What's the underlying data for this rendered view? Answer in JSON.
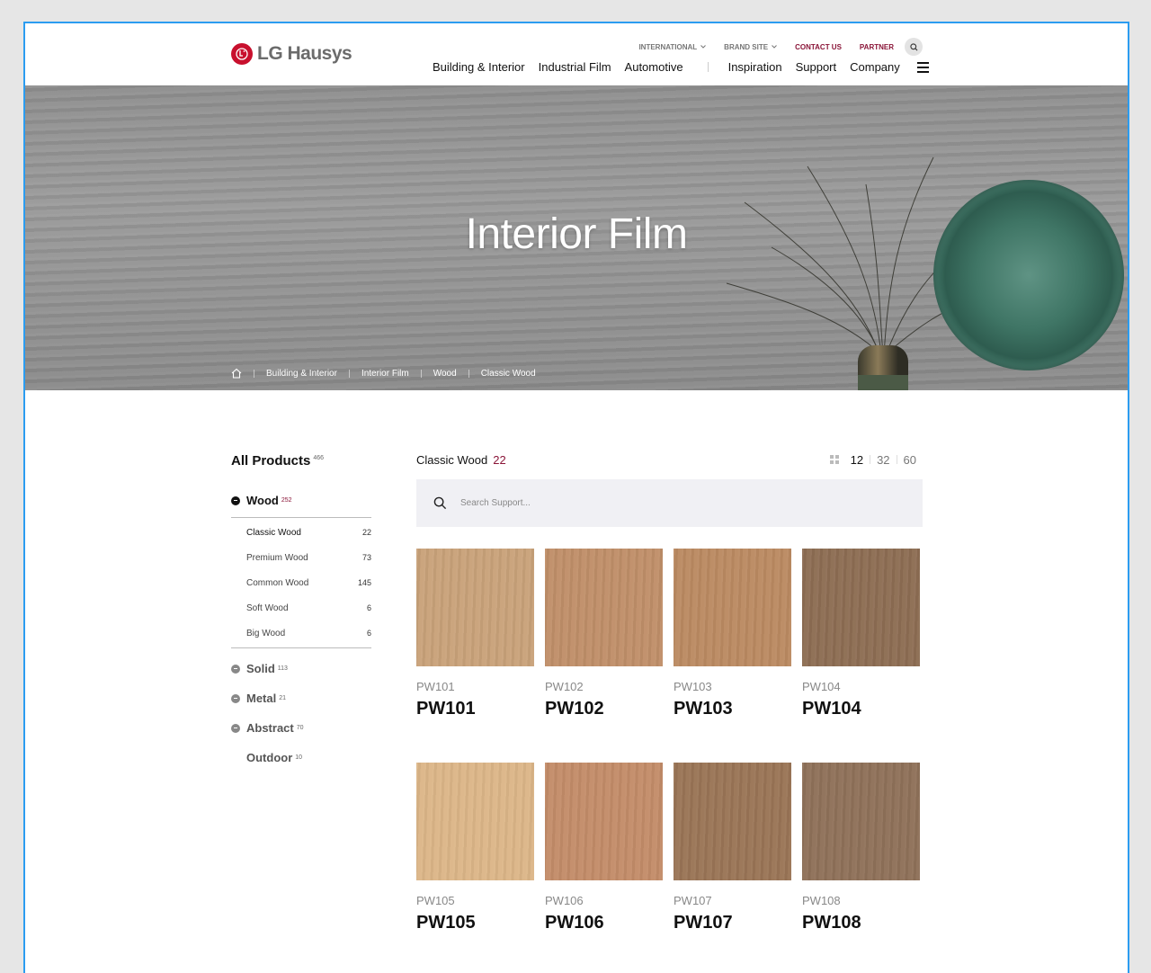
{
  "brand": {
    "name": "LG Hausys",
    "logo_letters": "LG",
    "accent": "#c8102e"
  },
  "utility_nav": {
    "international": "INTERNATIONAL",
    "brand_site": "BRAND SITE",
    "contact_us": "CONTACT US",
    "partner": "PARTNER"
  },
  "main_nav": {
    "building": "Building & Interior",
    "industrial": "Industrial Film",
    "automotive": "Automotive",
    "inspiration": "Inspiration",
    "support": "Support",
    "company": "Company"
  },
  "hero": {
    "title": "Interior Film"
  },
  "breadcrumb": [
    "Building & Interior",
    "Interior Film",
    "Wood",
    "Classic Wood"
  ],
  "sidebar": {
    "all_products": {
      "label": "All Products",
      "count": "466"
    },
    "categories": [
      {
        "label": "Wood",
        "count": "252"
      },
      {
        "label": "Solid",
        "count": "113"
      },
      {
        "label": "Metal",
        "count": "21"
      },
      {
        "label": "Abstract",
        "count": "70"
      },
      {
        "label": "Outdoor",
        "count": "10"
      }
    ],
    "wood_subs": [
      {
        "label": "Classic Wood",
        "count": "22"
      },
      {
        "label": "Premium Wood",
        "count": "73"
      },
      {
        "label": "Common Wood",
        "count": "145"
      },
      {
        "label": "Soft Wood",
        "count": "6"
      },
      {
        "label": "Big Wood",
        "count": "6"
      }
    ]
  },
  "content": {
    "title": "Classic Wood",
    "count": "22",
    "per_page": [
      "12",
      "32",
      "60"
    ],
    "search_placeholder": "Search Support..."
  },
  "products": [
    {
      "code": "PW101",
      "name": "PW101",
      "color": "#c9a27a"
    },
    {
      "code": "PW102",
      "name": "PW102",
      "color": "#c08f69"
    },
    {
      "code": "PW103",
      "name": "PW103",
      "color": "#bb8a62"
    },
    {
      "code": "PW104",
      "name": "PW104",
      "color": "#8d6d53"
    },
    {
      "code": "PW105",
      "name": "PW105",
      "color": "#dcb688"
    },
    {
      "code": "PW106",
      "name": "PW106",
      "color": "#c38c69"
    },
    {
      "code": "PW107",
      "name": "PW107",
      "color": "#9a7556"
    },
    {
      "code": "PW108",
      "name": "PW108",
      "color": "#8f7159"
    }
  ]
}
